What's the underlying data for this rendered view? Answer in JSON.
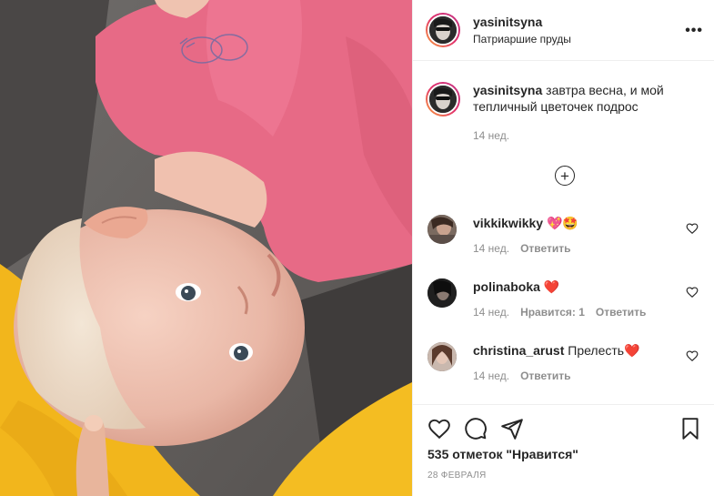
{
  "post": {
    "username": "yasinitsyna",
    "location": "Патриаршие пруды"
  },
  "caption": {
    "username": "yasinitsyna",
    "text": "завтра весна, и мой тепличный цветочек подрос",
    "time": "14 нед."
  },
  "comments": [
    {
      "username": "vikkikwikky",
      "text": "💖🤩",
      "time": "14 нед.",
      "likes": "",
      "reply_label": "Ответить"
    },
    {
      "username": "polinaboka",
      "text": "❤️",
      "time": "14 нед.",
      "likes": "Нравится: 1",
      "reply_label": "Ответить"
    },
    {
      "username": "christina_arust",
      "text": "Прелесть❤️",
      "time": "14 нед.",
      "likes": "",
      "reply_label": "Ответить"
    }
  ],
  "likes_text": "535 отметок \"Нравится\"",
  "date": "28 ФЕВРАЛЯ",
  "icons": {
    "more": "more-options-icon",
    "load_more": "plus-circle-icon",
    "like": "heart-icon",
    "comment": "comment-icon",
    "share": "paper-plane-icon",
    "save": "bookmark-icon"
  },
  "colors": {
    "accent_heart": "#ed4956",
    "muted": "#8e8e8e",
    "text": "#262626"
  }
}
